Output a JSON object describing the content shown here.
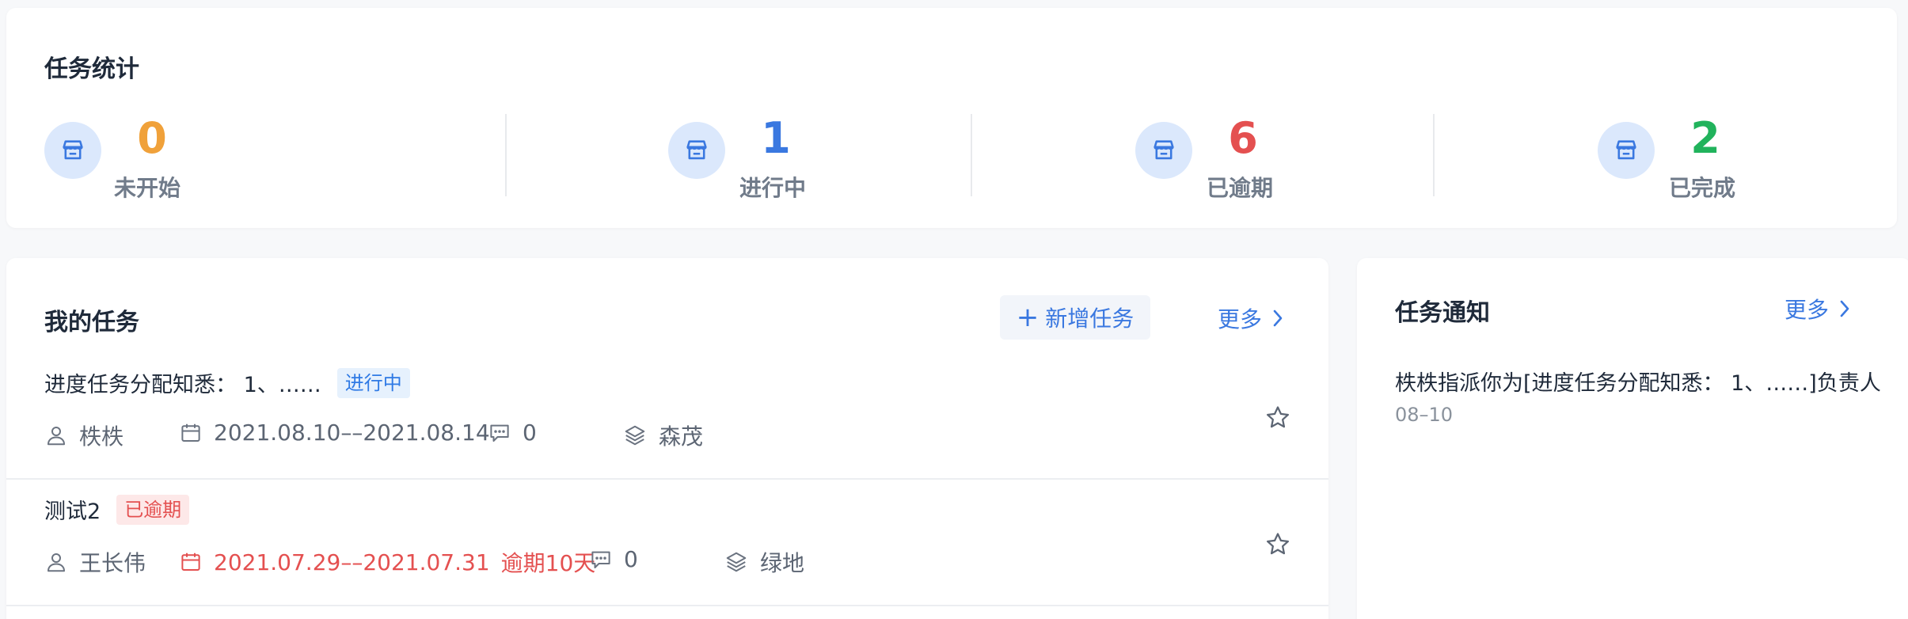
{
  "stats": {
    "title": "任务统计",
    "items": [
      {
        "value": "0",
        "label": "未开始",
        "color": "#f0a13a"
      },
      {
        "value": "1",
        "label": "进行中",
        "color": "#3a78e0"
      },
      {
        "value": "6",
        "label": "已逾期",
        "color": "#e45050"
      },
      {
        "value": "2",
        "label": "已完成",
        "color": "#21b35c"
      }
    ]
  },
  "my_tasks": {
    "title": "我的任务",
    "add_button": {
      "icon": "plus-icon",
      "label": "新增任务"
    },
    "more_label": "更多",
    "tasks": [
      {
        "title": "进度任务分配知悉： 1、……",
        "status": "进行中",
        "assignee": "柣柣",
        "date_range": "2021.08.10––2021.08.14",
        "overdue_note": "",
        "comments": "0",
        "project": "森茂"
      },
      {
        "title": "测试2",
        "status": "已逾期",
        "assignee": "王长伟",
        "date_range": "2021.07.29––2021.07.31",
        "overdue_note": "逾期10天",
        "comments": "0",
        "project": "绿地"
      }
    ]
  },
  "notifications": {
    "title": "任务通知",
    "more_label": "更多",
    "items": [
      {
        "text": "柣柣指派你为[进度任务分配知悉： 1、……]负责人",
        "date": "08–10"
      }
    ]
  },
  "colors": {
    "accent": "#3a78e0",
    "danger": "#e45050",
    "icon_bg": "#dbe8fc"
  }
}
